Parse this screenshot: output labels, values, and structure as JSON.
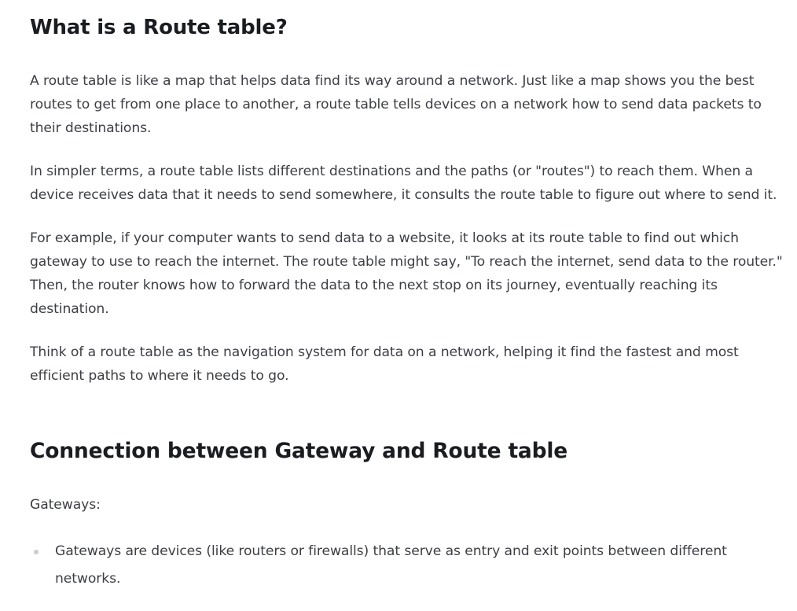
{
  "section1": {
    "heading": "What is a Route table?",
    "paragraphs": [
      "A route table is like a map that helps data find its way around a network. Just like a map shows you the best routes to get from one place to another, a route table tells devices on a network how to send data packets to their destinations.",
      "In simpler terms, a route table lists different destinations and the paths (or \"routes\") to reach them. When a device receives data that it needs to send somewhere, it consults the route table to figure out where to send it.",
      "For example, if your computer wants to send data to a website, it looks at its route table to find out which gateway to use to reach the internet. The route table might say, \"To reach the internet, send data to the router.\" Then, the router knows how to forward the data to the next stop on its journey, eventually reaching its destination.",
      "Think of a route table as the navigation system for data on a network, helping it find the fastest and most efficient paths to where it needs to go."
    ]
  },
  "section2": {
    "heading": "Connection between Gateway and Route table",
    "label": "Gateways:",
    "bullets": [
      "Gateways are devices (like routers or firewalls) that serve as entry and exit points between different networks."
    ]
  }
}
